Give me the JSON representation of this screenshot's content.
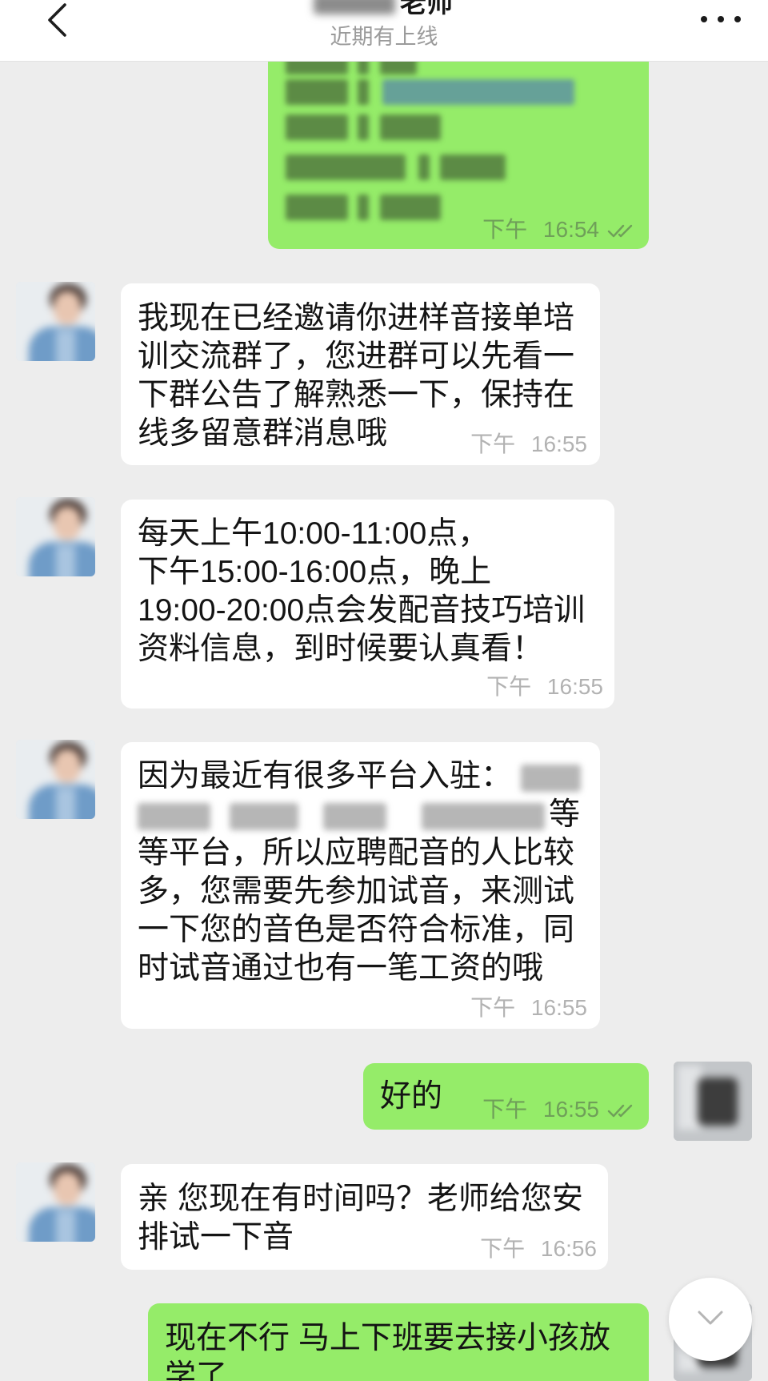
{
  "header": {
    "title": "老师",
    "subtitle": "近期有上线"
  },
  "messages": [
    {
      "side": "sent",
      "redacted": true,
      "time": "下午 16:54",
      "status_icon": "double-check-icon"
    },
    {
      "side": "received",
      "lines": [
        "我现在已经邀请你进样音接单培",
        "训交流群了，您进群可以先看一",
        "下群公告了解熟悉一下，保持在",
        "线多留意群消息哦"
      ],
      "time": "下午 16:55"
    },
    {
      "side": "received",
      "lines": [
        "每天上午10:00-11:00点，",
        "下午15:00-16:00点，晚上",
        "19:00-20:00点会发配音技巧培训",
        "资料信息，到时候要认真看！"
      ],
      "time": "下午 16:55"
    },
    {
      "side": "received",
      "lines": [
        "因为最近有很多平台入驻：",
        "等",
        "等平台，所以应聘配音的人比较",
        "多，您需要先参加试音，来测试",
        "一下您的音色是否符合标准，同",
        "时试音通过也有一笔工资的哦"
      ],
      "time": "下午 16:55"
    },
    {
      "side": "sent",
      "lines": [
        "好的"
      ],
      "time": "下午 16:55",
      "status_icon": "double-check-icon"
    },
    {
      "side": "received",
      "lines": [
        "亲 您现在有时间吗？老师给您安",
        "排试一下音"
      ],
      "time": "下午 16:56"
    },
    {
      "side": "sent",
      "lines": [
        "现在不行 马上下班要去接小孩放",
        "学了"
      ]
    }
  ],
  "icons": {
    "back": "chevron-left-icon",
    "more": "more-dots-icon",
    "read_status": "double-check-icon",
    "scroll_to_bottom": "chevron-down-icon"
  },
  "colors": {
    "background": "#ededed",
    "sent_bubble": "#95ec69",
    "received_bubble": "#ffffff",
    "time_received": "#b2b2b2",
    "time_sent": "#6f9f59"
  }
}
